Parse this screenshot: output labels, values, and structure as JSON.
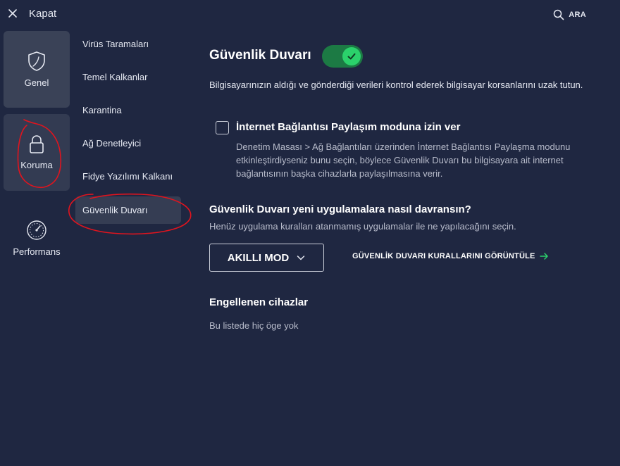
{
  "topbar": {
    "close_label": "Kapat",
    "search_label": "ARA"
  },
  "nav": {
    "items": [
      {
        "label": "Genel",
        "icon": "shield-icon"
      },
      {
        "label": "Koruma",
        "icon": "lock-icon"
      },
      {
        "label": "Performans",
        "icon": "speedometer-icon"
      }
    ]
  },
  "subnav": {
    "items": [
      {
        "label": "Virüs Taramaları"
      },
      {
        "label": "Temel Kalkanlar"
      },
      {
        "label": "Karantina"
      },
      {
        "label": "Ağ Denetleyici"
      },
      {
        "label": "Fidye Yazılımı Kalkanı"
      },
      {
        "label": "Güvenlik Duvarı",
        "active": true
      }
    ]
  },
  "main": {
    "title": "Güvenlik Duvarı",
    "toggle_on": true,
    "description": "Bilgisayarınızın aldığı ve gönderdiği verileri kontrol ederek bilgisayar korsanlarını uzak tutun.",
    "ics": {
      "label": "İnternet Bağlantısı Paylaşım moduna izin ver",
      "checked": false,
      "description": "Denetim Masası > Ağ Bağlantıları üzerinden İnternet Bağlantısı Paylaşma modunu etkinleştirdiyseniz bunu seçin, böylece Güvenlik Duvarı bu bilgisayara ait internet bağlantısının başka cihazlarla paylaşılmasına verir."
    },
    "behavior": {
      "title": "Güvenlik Duvarı yeni uygulamalara nasıl davransın?",
      "subtitle": "Henüz uygulama kuralları atanmamış uygulamalar ile ne yapılacağını seçin.",
      "mode_value": "AKILLI MOD",
      "rules_link": "GÜVENLİK DUVARI KURALLARINI GÖRÜNTÜLE"
    },
    "blocked": {
      "title": "Engellenen cihazlar",
      "empty_text": "Bu listede hiç öge yok"
    }
  },
  "colors": {
    "background": "#1f2741",
    "tile_active": "#3a4257",
    "toggle_track": "#1c7a44",
    "toggle_knob": "#2bd16b",
    "link_arrow": "#2bd16b",
    "annotation_red": "#e0141e"
  }
}
